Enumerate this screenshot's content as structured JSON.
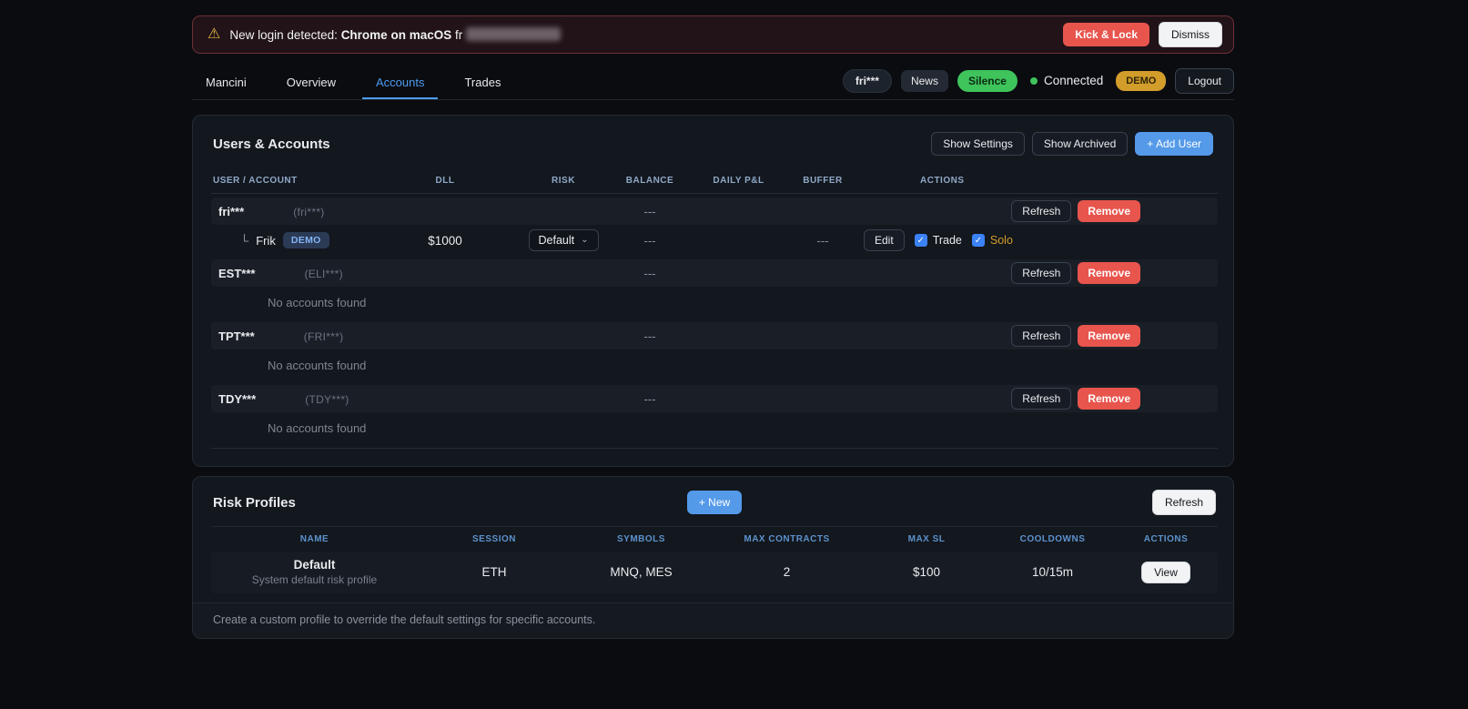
{
  "colors": {
    "accent": "#4f9cf0",
    "danger": "#e8554d",
    "success": "#3fc35b",
    "warning": "#e3b341",
    "demo_gold": "#d29d2b"
  },
  "banner": {
    "message_prefix": "New login detected:",
    "message_device": "Chrome on macOS",
    "message_suffix": "fr",
    "kick_lock_label": "Kick & Lock",
    "dismiss_label": "Dismiss"
  },
  "nav": {
    "tabs": [
      "Mancini",
      "Overview",
      "Accounts",
      "Trades"
    ],
    "active_tab": "Accounts",
    "user_pill": "fri***",
    "news_label": "News",
    "silence_label": "Silence",
    "connected_label": "Connected",
    "demo_badge": "DEMO",
    "logout_label": "Logout"
  },
  "users_section": {
    "title": "Users & Accounts",
    "show_settings_label": "Show Settings",
    "show_archived_label": "Show Archived",
    "add_user_label": "+ Add User",
    "columns": [
      "USER / ACCOUNT",
      "DLL",
      "RISK",
      "BALANCE",
      "DAILY P&L",
      "BUFFER",
      "ACTIONS"
    ],
    "actions": {
      "refresh": "Refresh",
      "remove": "Remove"
    },
    "empty_text": "No accounts found",
    "users": [
      {
        "name": "fri***",
        "alias": "(fri***)",
        "balance": "---"
      },
      {
        "name": "EST***",
        "alias": "(ELI***)",
        "balance": "---"
      },
      {
        "name": "TPT***",
        "alias": "(FRI***)",
        "balance": "---"
      },
      {
        "name": "TDY***",
        "alias": "(TDY***)",
        "balance": "---"
      }
    ],
    "account": {
      "tree": "└",
      "name": "Frik",
      "badge": "DEMO",
      "dll": "$1000",
      "risk": "Default",
      "balance": "---",
      "buffer": "---",
      "edit_label": "Edit",
      "trade_label": "Trade",
      "solo_label": "Solo"
    }
  },
  "risk_section": {
    "title": "Risk Profiles",
    "new_label": "+ New",
    "refresh_label": "Refresh",
    "columns": [
      "NAME",
      "SESSION",
      "SYMBOLS",
      "MAX CONTRACTS",
      "MAX SL",
      "COOLDOWNS",
      "ACTIONS"
    ],
    "profiles": [
      {
        "name": "Default",
        "description": "System default risk profile",
        "session": "ETH",
        "symbols": "MNQ, MES",
        "max_contracts": "2",
        "max_sl": "$100",
        "cooldowns": "10/15m",
        "view_label": "View"
      }
    ],
    "footer_note": "Create a custom profile to override the default settings for specific accounts."
  }
}
